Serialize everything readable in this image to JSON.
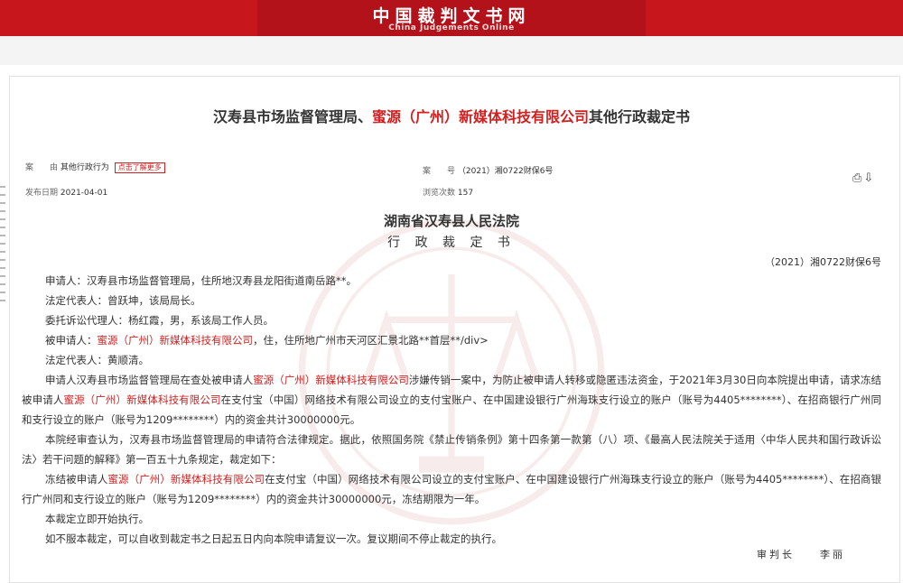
{
  "site": {
    "title_cn": "中国裁判文书网",
    "title_en": "China Judgements Online"
  },
  "document": {
    "title_parts": [
      {
        "text": "汉寿县市场监督管理局、",
        "red": false
      },
      {
        "text": "蜜源（广州）新媒体科技有限公司",
        "red": true
      },
      {
        "text": "其他行政裁定书",
        "red": false
      }
    ],
    "meta": {
      "cause_label": "案　　由",
      "cause_value": "其他行政行为",
      "cause_tag": "点击了解更多",
      "caseno_label": "案　　号",
      "caseno_value": "（2021）湘0722财保6号",
      "date_label": "发布日期",
      "date_value": "2021-04-01",
      "views_label": "浏览次数",
      "views_value": "157"
    },
    "court": "湖南省汉寿县人民法院",
    "doctype": "行 政 裁 定 书",
    "case_number": "（2021）湘0722财保6号",
    "paragraphs": [
      [
        {
          "text": "申请人：汉寿县市场监督管理局，住所地汉寿县龙阳街道南岳路**。",
          "red": false
        }
      ],
      [
        {
          "text": "法定代表人：曾跃坤，该局局长。",
          "red": false
        }
      ],
      [
        {
          "text": "委托诉讼代理人：杨红霞，男，系该局工作人员。",
          "red": false
        }
      ],
      [
        {
          "text": "被申请人：",
          "red": false
        },
        {
          "text": "蜜源（广州）新媒体科技有限公司",
          "red": true
        },
        {
          "text": "，住，住所地广州市天河区汇景北路**首层**/div>",
          "red": false
        }
      ],
      [
        {
          "text": "法定代表人：黄顺清。",
          "red": false
        }
      ],
      [
        {
          "text": "申请人汉寿县市场监督管理局在查处被申请人",
          "red": false
        },
        {
          "text": "蜜源（广州）新媒体科技有限公司",
          "red": true
        },
        {
          "text": "涉嫌传销一案中，为防止被申请人转移或隐匿违法资金，于2021年3月30日向本院提出申请，请求冻结被申请人",
          "red": false
        },
        {
          "text": "蜜源（广州）新媒体科技有限公司",
          "red": true
        },
        {
          "text": "在支付宝（中国）网络技术有限公司设立的支付宝账户、在中国建设银行广州海珠支行设立的账户（账号为4405********）、在招商银行广州同和支行设立的账户（账号为1209********）内的资金共计30000000元。",
          "red": false
        }
      ],
      [
        {
          "text": "本院经审查认为，汉寿县市场监督管理局的申请符合法律规定。据此，依照国务院《禁止传销条例》第十四条第一款第（八）项、《最高人民法院关于适用〈中华人民共和国行政诉讼法〉若干问题的解释》第一百五十九条规定，裁定如下：",
          "red": false
        }
      ],
      [
        {
          "text": "冻结被申请人",
          "red": false
        },
        {
          "text": "蜜源（广州）新媒体科技有限公司",
          "red": true
        },
        {
          "text": "在支付宝（中国）网络技术有限公司设立的支付宝账户、在中国建设银行广州海珠支行设立的账户（账号为4405********）、在招商银行广州同和支行设立的账户（账号为1209********）内的资金共计30000000元，冻结期限为一年。",
          "red": false
        }
      ],
      [
        {
          "text": "本裁定立即开始执行。",
          "red": false
        }
      ],
      [
        {
          "text": "如不服本裁定，可以自收到裁定书之日起五日内向本院申请复议一次。复议期间不停止裁定的执行。",
          "red": false
        }
      ]
    ],
    "signature": "审判长　　李丽"
  },
  "icons": {
    "print": "print-icon",
    "download": "download-icon"
  }
}
